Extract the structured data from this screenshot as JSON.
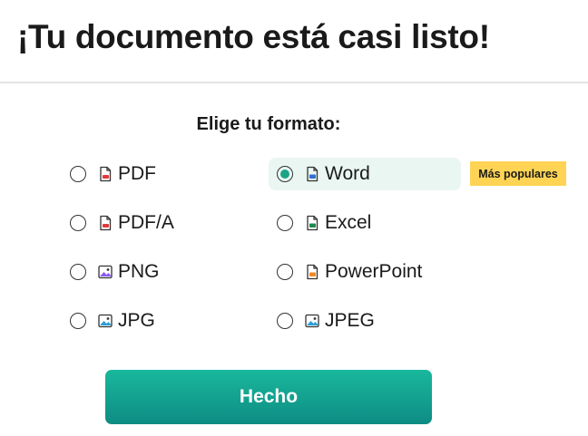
{
  "header": {
    "title": "¡Tu documento está casi listo!"
  },
  "format_section": {
    "heading": "Elige tu formato:"
  },
  "options": [
    {
      "id": "pdf",
      "label": "PDF",
      "icon": "pdf-file-icon",
      "color": "#e03a3a",
      "selected": false
    },
    {
      "id": "word",
      "label": "Word",
      "icon": "word-file-icon",
      "color": "#2f6fd6",
      "selected": true
    },
    {
      "id": "pdfa",
      "label": "PDF/A",
      "icon": "pdf-file-icon",
      "color": "#e03a3a",
      "selected": false
    },
    {
      "id": "excel",
      "label": "Excel",
      "icon": "excel-file-icon",
      "color": "#1d8a4e",
      "selected": false
    },
    {
      "id": "png",
      "label": "PNG",
      "icon": "image-icon",
      "color": "#8b5cf6",
      "selected": false
    },
    {
      "id": "powerpoint",
      "label": "PowerPoint",
      "icon": "powerpoint-file-icon",
      "color": "#f08a24",
      "selected": false
    },
    {
      "id": "jpg",
      "label": "JPG",
      "icon": "image-icon",
      "color": "#2a9fd6",
      "selected": false
    },
    {
      "id": "jpeg",
      "label": "JPEG",
      "icon": "image-icon",
      "color": "#2a9fd6",
      "selected": false
    }
  ],
  "badge": {
    "label": "Más populares",
    "color": "#ffd454"
  },
  "actions": {
    "done_label": "Hecho"
  },
  "colors": {
    "accent": "#1aa384",
    "selected_bg": "#e9f6f2",
    "button_top": "#19b89c",
    "button_bottom": "#0e8c84"
  }
}
